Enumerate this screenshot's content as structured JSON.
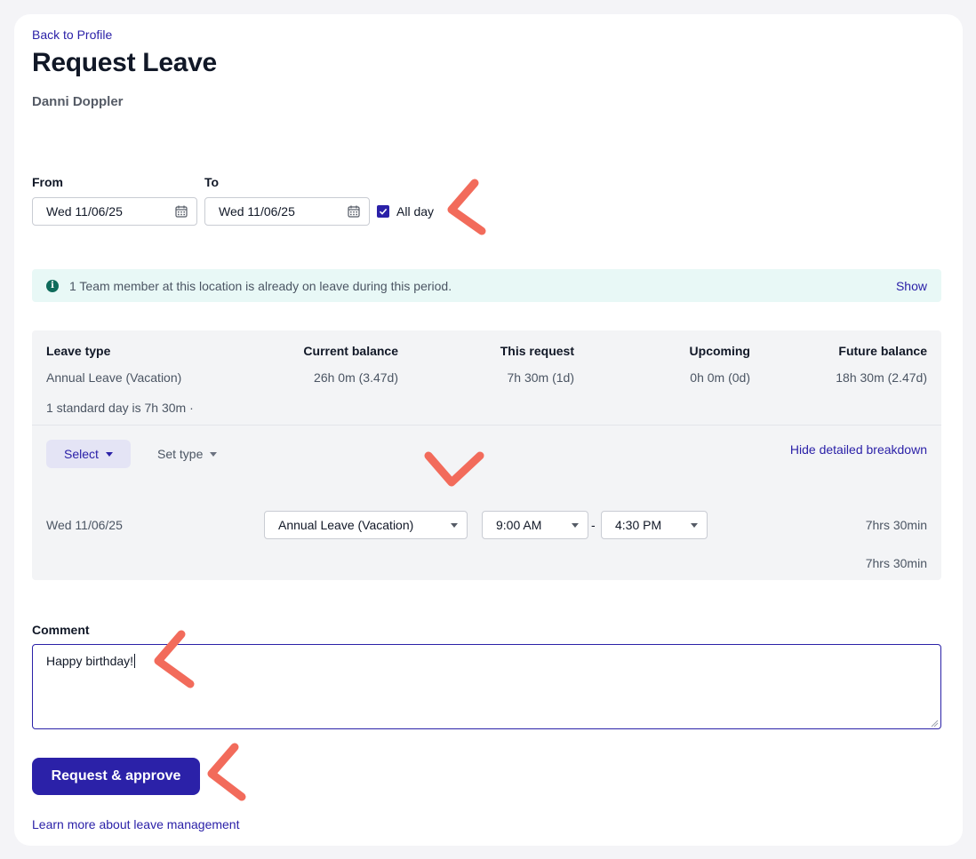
{
  "nav": {
    "back_link": "Back to Profile"
  },
  "page": {
    "title": "Request Leave",
    "employee_name": "Danni Doppler"
  },
  "dates": {
    "from_label": "From",
    "from_value": "Wed 11/06/25",
    "to_label": "To",
    "to_value": "Wed 11/06/25",
    "all_day_label": "All day",
    "all_day_checked": true
  },
  "alert": {
    "message": "1 Team member at this location is already on leave during this period.",
    "action": "Show",
    "icon": "info-icon"
  },
  "summary": {
    "headers": [
      "Leave type",
      "Current balance",
      "This request",
      "Upcoming",
      "Future balance"
    ],
    "row": [
      "Annual Leave (Vacation)",
      "26h 0m (3.47d)",
      "7h 30m (1d)",
      "0h 0m (0d)",
      "18h 30m (2.47d)"
    ],
    "note": "1 standard day is 7h 30m ·"
  },
  "breakdown": {
    "select_label": "Select",
    "set_type_label": "Set type",
    "toggle_link": "Hide detailed breakdown",
    "row": {
      "date": "Wed 11/06/25",
      "leave_type": "Annual Leave (Vacation)",
      "start_time": "9:00 AM",
      "separator": "-",
      "end_time": "4:30 PM",
      "duration": "7hrs 30min"
    },
    "total": "7hrs 30min"
  },
  "comment": {
    "label": "Comment",
    "value": "Happy birthday!"
  },
  "actions": {
    "submit": "Request & approve",
    "learn_more": "Learn more about leave management"
  },
  "colors": {
    "accent": "#2b21a8",
    "alert_bg": "#e8f8f6",
    "annotation": "#f26b5b"
  }
}
